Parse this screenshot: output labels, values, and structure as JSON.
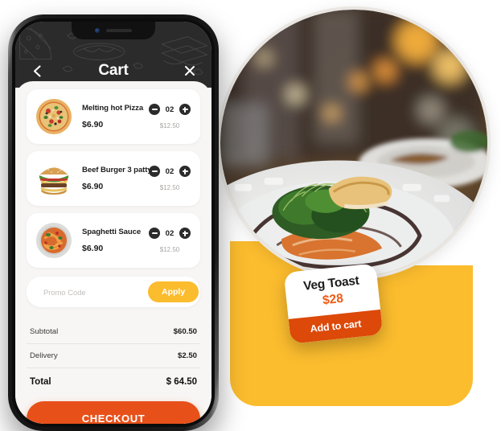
{
  "app": {
    "header": {
      "title": "Cart",
      "back_icon": "chevron-left-icon",
      "close_icon": "close-icon"
    }
  },
  "cart": {
    "items": [
      {
        "name": "Melting hot Pizza",
        "price": "$6.90",
        "qty": "02",
        "original_price": "$12.50",
        "image": "pizza"
      },
      {
        "name": "Beef Burger 3 patty",
        "price": "$6.90",
        "qty": "02",
        "original_price": "$12.50",
        "image": "burger"
      },
      {
        "name": "Spaghetti Sauce",
        "price": "$6.90",
        "qty": "02",
        "original_price": "$12.50",
        "image": "spaghetti"
      }
    ],
    "promo": {
      "icon": "coupon-icon",
      "placeholder": "Promo Code",
      "value": "",
      "apply_label": "Apply"
    },
    "summary": [
      {
        "label": "Subtotal",
        "value": "$60.50"
      },
      {
        "label": "Delivery",
        "value": "$2.50"
      }
    ],
    "total": {
      "label": "Total",
      "value": "$ 64.50"
    },
    "checkout_label": "CHECKOUT"
  },
  "hero": {
    "product_card": {
      "title": "Veg Toast",
      "price": "$28",
      "cta_label": "Add to cart"
    }
  },
  "colors": {
    "orange": "#E8501A",
    "orange_dark": "#DC4908",
    "orange_price": "#EF5A14",
    "amber": "#FBBC2E",
    "dark": "#2B2B2B"
  }
}
